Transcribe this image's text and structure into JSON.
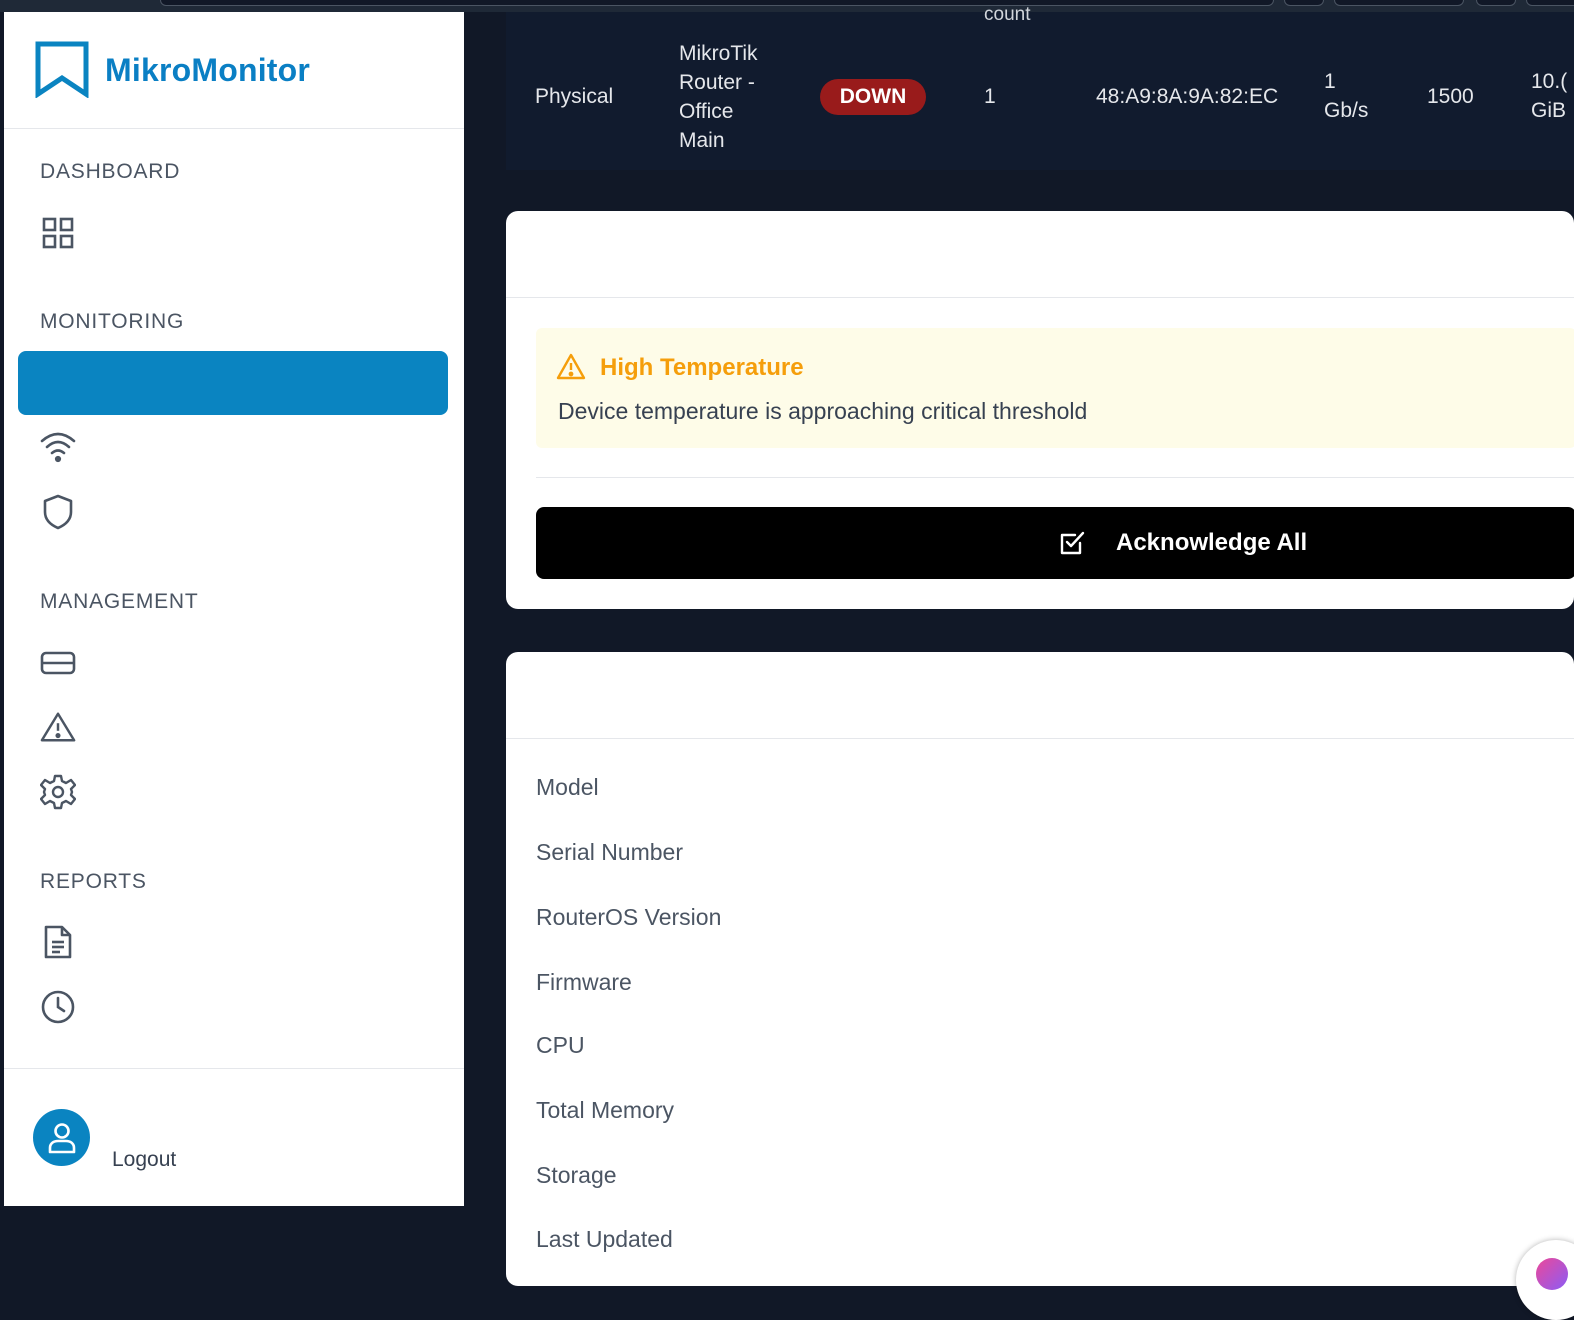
{
  "app": {
    "brand_name": "MikroMonitor",
    "accent": "#0a84c1"
  },
  "sidebar": {
    "sections": [
      {
        "title": "DASHBOARD"
      },
      {
        "title": "MONITORING"
      },
      {
        "title": "MANAGEMENT"
      },
      {
        "title": "REPORTS"
      }
    ],
    "icons": [
      "dashboard-grid-icon",
      "wifi-icon",
      "shield-icon",
      "card-icon",
      "warning-icon",
      "gear-icon",
      "document-icon",
      "clock-icon"
    ],
    "logout_label": "Logout"
  },
  "interface_table": {
    "header_fragment": "count",
    "row": {
      "type": "Physical",
      "device": "MikroTik Router - Office Main",
      "status": "DOWN",
      "count": "1",
      "mac": "48:A9:8A:9A:82:EC",
      "speed": "1 Gb/s",
      "mtu": "1500",
      "traffic": "10.( GiB"
    },
    "status_color": "#991b1b"
  },
  "alerts_card": {
    "alert": {
      "title": "High Temperature",
      "message": "Device temperature is approaching critical threshold",
      "color": "#f59e0b"
    },
    "acknowledge_label": "Acknowledge All"
  },
  "device_info": {
    "labels": [
      "Model",
      "Serial Number",
      "RouterOS Version",
      "Firmware",
      "CPU",
      "Total Memory",
      "Storage",
      "Last Updated"
    ]
  }
}
